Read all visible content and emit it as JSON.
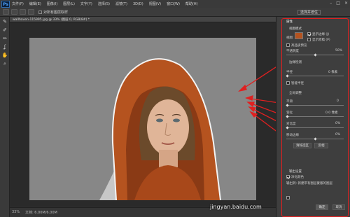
{
  "app": {
    "logo": "Ps"
  },
  "menu": [
    "文件(F)",
    "编辑(E)",
    "图像(I)",
    "图层(L)",
    "文字(Y)",
    "选择(S)",
    "滤镜(T)",
    "3D(D)",
    "视图(V)",
    "窗口(W)",
    "帮助(H)"
  ],
  "window_controls": [
    "–",
    "□",
    "×"
  ],
  "options_bar": {
    "checkbox_label": "对所有图层取样",
    "right_button": "选择并遮住"
  },
  "document": {
    "tab_title": "wallhaven-115995.jpg @ 33% (图层 0, RGB/8#) *"
  },
  "status": {
    "zoom": "33%",
    "doc_size": "文档: 6.00M/6.00M"
  },
  "panel": {
    "title": "属性",
    "view_mode_header": "视图模式",
    "view_label": "视图:",
    "show_edge": "显示边缘 (J)",
    "show_original": "显示原稿 (P)",
    "high_quality": "高品质预览",
    "opacity_label": "不透明度",
    "opacity_value": "50%",
    "opacity_fraction": 0.5,
    "edge_detection": "边缘检测",
    "radius_label": "半径",
    "radius_value": "0 像素",
    "radius_fraction": 0.0,
    "smart_radius": "智能半径",
    "global_refine": "全局调整",
    "smooth_label": "平滑",
    "smooth_value": "0",
    "feather_label": "羽化",
    "feather_value": "0.0 像素",
    "contrast_label": "对比度",
    "contrast_value": "0%",
    "shift_edge_label": "移动边缘",
    "shift_edge_value": "0%",
    "clear_selection": "清除选区",
    "invert": "反相",
    "output_settings": "输出设置",
    "decontaminate": "净化颜色",
    "output_to": "输出到: 新建带有图层蒙版的图层",
    "ok": "确定",
    "cancel": "取消"
  },
  "watermark": "jingyan.baidu.com",
  "colors": {
    "accent_red": "#e02020",
    "hood": "#b5531f",
    "canvas_bg": "#878787"
  }
}
